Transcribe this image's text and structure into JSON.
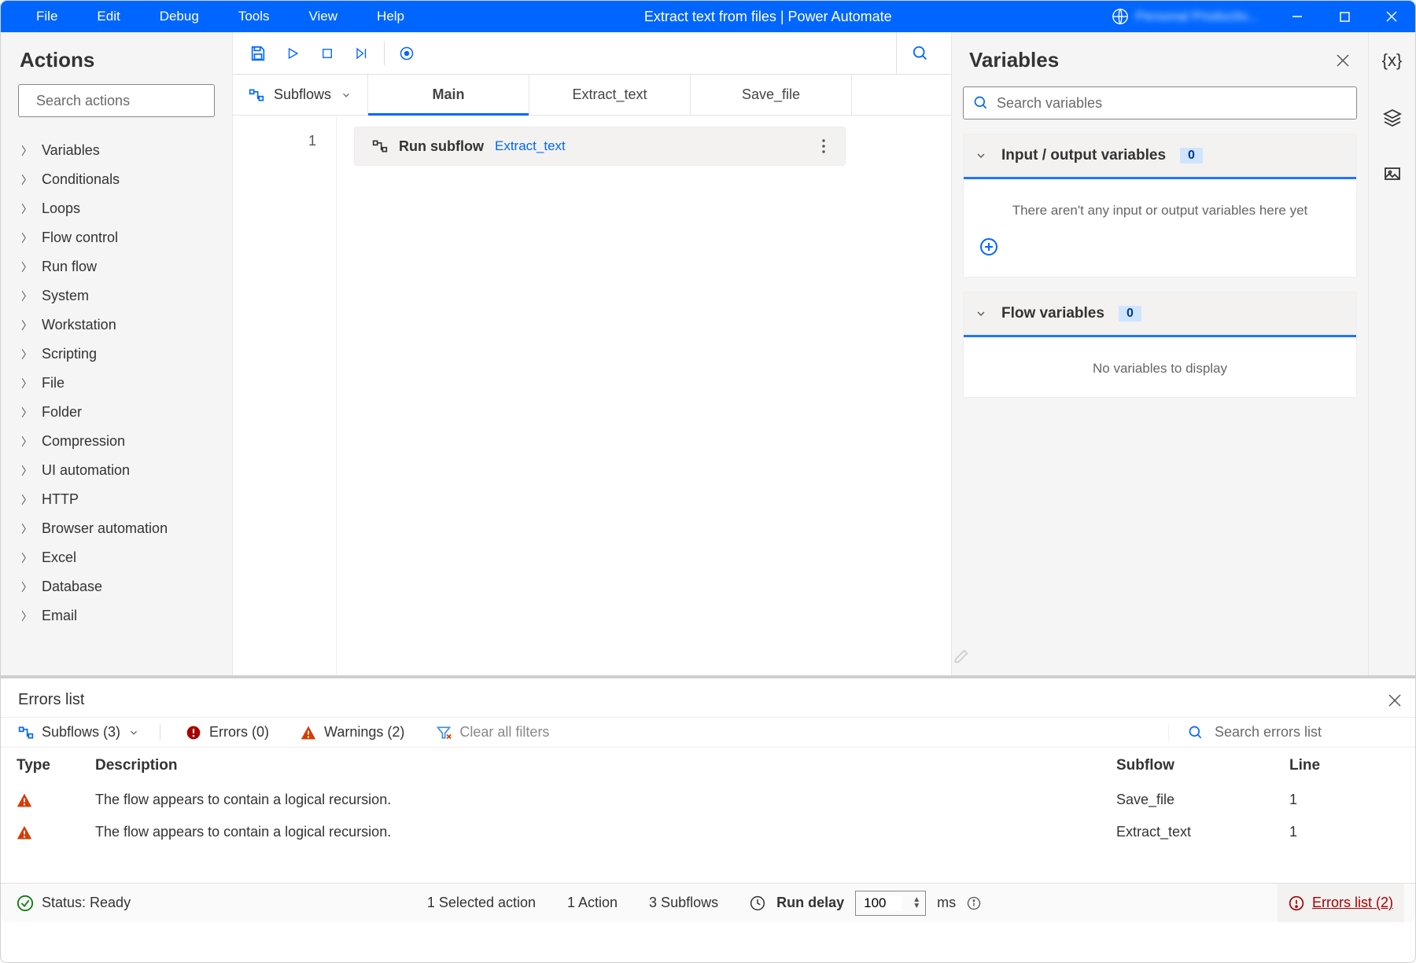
{
  "title": "Extract text from files | Power Automate",
  "menu": [
    "File",
    "Edit",
    "Debug",
    "Tools",
    "View",
    "Help"
  ],
  "account_label": "Personal Productiv...",
  "actions": {
    "header": "Actions",
    "search_placeholder": "Search actions",
    "categories": [
      "Variables",
      "Conditionals",
      "Loops",
      "Flow control",
      "Run flow",
      "System",
      "Workstation",
      "Scripting",
      "File",
      "Folder",
      "Compression",
      "UI automation",
      "HTTP",
      "Browser automation",
      "Excel",
      "Database",
      "Email"
    ]
  },
  "tabs": {
    "subflows": "Subflows",
    "items": [
      "Main",
      "Extract_text",
      "Save_file"
    ],
    "active": "Main"
  },
  "step": {
    "number": "1",
    "action": "Run subflow",
    "target": "Extract_text"
  },
  "variables": {
    "title": "Variables",
    "search_placeholder": "Search variables",
    "io_title": "Input / output variables",
    "io_count": "0",
    "io_empty": "There aren't any input or output variables here yet",
    "flow_title": "Flow variables",
    "flow_count": "0",
    "flow_empty": "No variables to display"
  },
  "errors": {
    "title": "Errors list",
    "subflows_filter": "Subflows (3)",
    "errors_filter": "Errors (0)",
    "warnings_filter": "Warnings (2)",
    "clear": "Clear all filters",
    "search_placeholder": "Search errors list",
    "cols": {
      "type": "Type",
      "desc": "Description",
      "sub": "Subflow",
      "line": "Line"
    },
    "rows": [
      {
        "desc": "The flow appears to contain a logical recursion.",
        "sub": "Save_file",
        "line": "1"
      },
      {
        "desc": "The flow appears to contain a logical recursion.",
        "sub": "Extract_text",
        "line": "1"
      }
    ]
  },
  "status": {
    "ready": "Status: Ready",
    "selected": "1 Selected action",
    "actions": "1 Action",
    "subflows": "3 Subflows",
    "delay_label": "Run delay",
    "delay_value": "100",
    "delay_unit": "ms",
    "errors_link": "Errors list (2)"
  }
}
